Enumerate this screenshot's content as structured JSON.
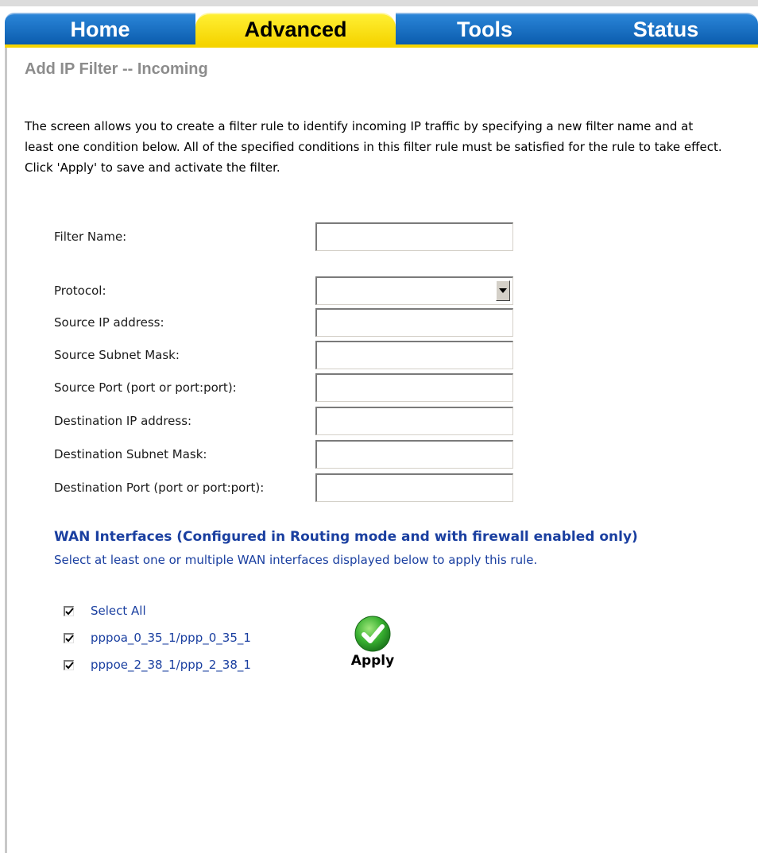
{
  "nav": {
    "tabs": [
      {
        "label": "Home",
        "active": false
      },
      {
        "label": "Advanced",
        "active": true
      },
      {
        "label": "Tools",
        "active": false
      },
      {
        "label": "Status",
        "active": false
      }
    ]
  },
  "page": {
    "title": "Add IP Filter -- Incoming",
    "intro": "The screen allows you to create a filter rule to identify incoming IP traffic by specifying a new filter name and at least one condition below. All of the specified conditions in this filter rule must be satisfied for the rule to take effect. Click 'Apply' to save and activate the filter."
  },
  "form": {
    "filter_name": {
      "label": "Filter Name:",
      "value": ""
    },
    "protocol": {
      "label": "Protocol:",
      "selected": ""
    },
    "source_ip": {
      "label": "Source IP address:",
      "value": ""
    },
    "source_mask": {
      "label": "Source Subnet Mask:",
      "value": ""
    },
    "source_port": {
      "label": "Source Port (port or port:port):",
      "value": ""
    },
    "dest_ip": {
      "label": "Destination IP address:",
      "value": ""
    },
    "dest_mask": {
      "label": "Destination Subnet Mask:",
      "value": ""
    },
    "dest_port": {
      "label": "Destination Port (port or port:port):",
      "value": ""
    }
  },
  "wan": {
    "heading": "WAN Interfaces (Configured in Routing mode and with firewall enabled only)",
    "description": "Select at least one or multiple WAN interfaces displayed below to apply this rule.",
    "items": [
      {
        "label": "Select All",
        "checked": true
      },
      {
        "label": "pppoa_0_35_1/ppp_0_35_1",
        "checked": true
      },
      {
        "label": "pppoe_2_38_1/ppp_2_38_1",
        "checked": true
      }
    ]
  },
  "actions": {
    "apply_label": "Apply"
  },
  "colors": {
    "nav_blue": "#0b5cad",
    "nav_active": "#f5d400",
    "title_gray": "#8c8c8c",
    "wan_text": "#1a3fa0",
    "apply_green": "#2fa82f"
  },
  "icons": {
    "apply": "checkmark-circle-icon",
    "select_arrow": "chevron-down-icon",
    "checkbox": "checkmark-icon"
  }
}
